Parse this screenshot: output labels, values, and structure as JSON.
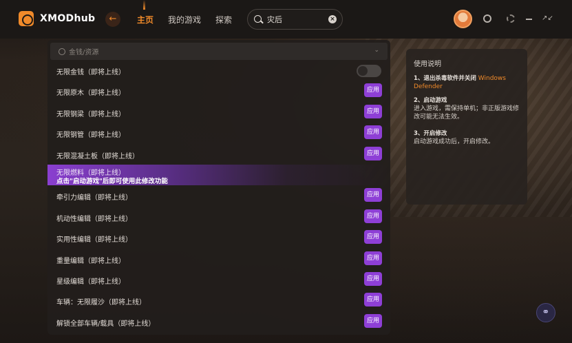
{
  "app": {
    "name": "XMODhub"
  },
  "nav": {
    "items": [
      "主页",
      "我的游戏",
      "探索"
    ],
    "active": 0
  },
  "search": {
    "value": "灾后",
    "placeholder": ""
  },
  "section": {
    "title": "金钱/资源"
  },
  "apply_label": "应用",
  "rows": [
    {
      "label": "无限金钱（即将上线）",
      "control": "toggle",
      "enabled": false
    },
    {
      "label": "无限原木（即将上线）",
      "control": "button"
    },
    {
      "label": "无限钢梁（即将上线）",
      "control": "button"
    },
    {
      "label": "无限钢管（即将上线）",
      "control": "button"
    },
    {
      "label": "无限混凝土板（即将上线）",
      "control": "button"
    },
    {
      "label": "无限燃料（即将上线）",
      "control": "none",
      "hint": "点击\"启动游戏\"后即可使用此修改功能"
    },
    {
      "label": "牵引力编辑（即将上线）",
      "control": "button"
    },
    {
      "label": "机动性编辑（即将上线）",
      "control": "button"
    },
    {
      "label": "实用性编辑（即将上线）",
      "control": "button"
    },
    {
      "label": "重量编辑（即将上线）",
      "control": "button"
    },
    {
      "label": "星级编辑（即将上线）",
      "control": "button"
    },
    {
      "label": "车辆：无限履沙（即将上线）",
      "control": "button"
    },
    {
      "label": "解锁全部车辆/载具（即将上线）",
      "control": "button"
    }
  ],
  "help": {
    "title": "使用说明",
    "steps": [
      {
        "title": "1、退出杀毒软件并关闭",
        "accent": "Windows Defender",
        "body": ""
      },
      {
        "title": "2、启动游戏",
        "accent": "",
        "body": "进入游戏，需保持单机；非正版游戏修改可能无法生效。"
      },
      {
        "title": "3、开启修改",
        "accent": "",
        "body": "启动游戏成功后，开启修改。"
      }
    ]
  },
  "colors": {
    "accent": "#f08a2a",
    "apply": "#8e3fd6",
    "highlight": "#8a3fd0"
  }
}
